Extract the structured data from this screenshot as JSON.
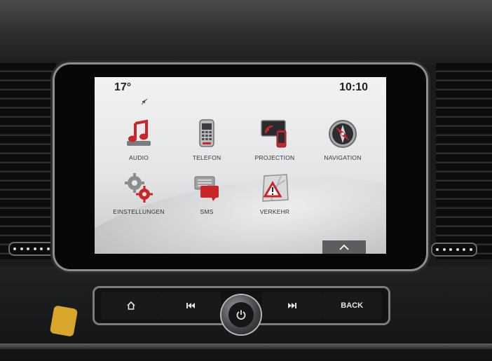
{
  "status": {
    "temperature": "17°",
    "time": "10:10"
  },
  "apps": [
    {
      "label": "AUDIO",
      "icon": "audio-note-icon"
    },
    {
      "label": "TELEFON",
      "icon": "phone-icon"
    },
    {
      "label": "PROJECTION",
      "icon": "projection-icon"
    },
    {
      "label": "NAVIGATION",
      "icon": "compass-icon"
    },
    {
      "label": "EINSTELLUNGEN",
      "icon": "gears-icon"
    },
    {
      "label": "SMS",
      "icon": "message-icon"
    },
    {
      "label": "VERKEHR",
      "icon": "traffic-warning-icon"
    }
  ],
  "hardware": {
    "home_icon": "home-icon",
    "prev_icon": "previous-track-icon",
    "power_icon": "power-icon",
    "next_icon": "next-track-icon",
    "back_label": "BACK"
  },
  "colors": {
    "accent_red": "#c8262a",
    "screen_bg": "#e9eaeb"
  }
}
